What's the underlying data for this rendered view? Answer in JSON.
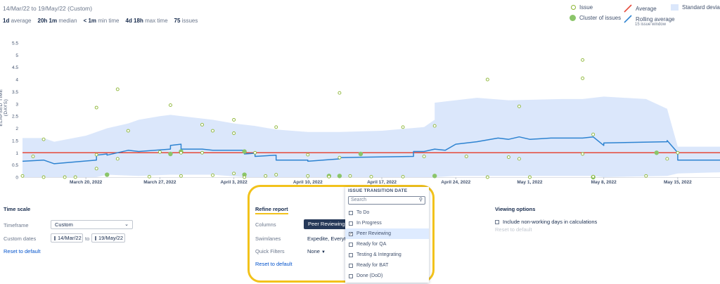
{
  "header": {
    "date_range": "14/Mar/22 to 19/May/22 (Custom)",
    "stats": [
      {
        "value": "1d",
        "label": "average"
      },
      {
        "value": "20h 1m",
        "label": "median"
      },
      {
        "value": "< 1m",
        "label": "min time"
      },
      {
        "value": "4d 18h",
        "label": "max time"
      },
      {
        "value": "75",
        "label": "issues"
      }
    ]
  },
  "legend": {
    "issue": "Issue",
    "cluster": "Cluster of issues",
    "average": "Average",
    "rolling": "Rolling average",
    "rolling_sub": "15 issue window",
    "stddev": "Standard deviation"
  },
  "colors": {
    "point": "#8bb532",
    "average": "#e5493a",
    "rolling": "#2d83d1",
    "band": "#dbe7fb",
    "highlight": "#f2c21b",
    "link": "#0052cc"
  },
  "chart_data": {
    "type": "scatter",
    "ylabel": "ELAPSED TIME (DAYS)",
    "ylim": [
      0,
      5.5
    ],
    "yticks": [
      "0",
      "0.5",
      "1",
      "1.5",
      "2",
      "2.5",
      "3",
      "3.5",
      "4",
      "4.5",
      "5",
      "5.5"
    ],
    "xlim": [
      "2022-03-14",
      "2022-05-19"
    ],
    "xticks": [
      {
        "date": "2022-03-20",
        "label": "March 20, 2022"
      },
      {
        "date": "2022-03-27",
        "label": "March 27, 2022"
      },
      {
        "date": "2022-04-03",
        "label": "April 3, 2022"
      },
      {
        "date": "2022-04-10",
        "label": "April 10, 2022"
      },
      {
        "date": "2022-04-17",
        "label": "April 17, 2022"
      },
      {
        "date": "2022-04-24",
        "label": "April 24, 2022"
      },
      {
        "date": "2022-05-01",
        "label": "May 1, 2022"
      },
      {
        "date": "2022-05-08",
        "label": "May 8, 2022"
      },
      {
        "date": "2022-05-15",
        "label": "May 15, 2022"
      }
    ],
    "average": 1.0,
    "issues": [
      [
        "2022-03-14",
        0.05
      ],
      [
        "2022-03-15",
        0.85
      ],
      [
        "2022-03-16",
        1.55
      ],
      [
        "2022-03-16",
        0.0
      ],
      [
        "2022-03-18",
        0.0
      ],
      [
        "2022-03-19",
        0.0
      ],
      [
        "2022-03-21",
        2.85
      ],
      [
        "2022-03-21",
        0.92
      ],
      [
        "2022-03-21",
        0.35
      ],
      [
        "2022-03-23",
        3.6
      ],
      [
        "2022-03-23",
        0.75
      ],
      [
        "2022-03-24",
        1.9
      ],
      [
        "2022-03-26",
        0.02
      ],
      [
        "2022-03-27",
        1.03
      ],
      [
        "2022-03-28",
        2.95
      ],
      [
        "2022-03-29",
        1.0
      ],
      [
        "2022-03-29",
        0.05
      ],
      [
        "2022-03-31",
        2.15
      ],
      [
        "2022-03-31",
        1.0
      ],
      [
        "2022-04-01",
        1.9
      ],
      [
        "2022-04-01",
        0.08
      ],
      [
        "2022-04-03",
        1.8
      ],
      [
        "2022-04-03",
        2.35
      ],
      [
        "2022-04-03",
        0.15
      ],
      [
        "2022-04-04",
        0.0
      ],
      [
        "2022-04-05",
        1.0
      ],
      [
        "2022-04-06",
        0.05
      ],
      [
        "2022-04-07",
        2.05
      ],
      [
        "2022-04-07",
        0.1
      ],
      [
        "2022-04-10",
        0.92
      ],
      [
        "2022-04-10",
        0.05
      ],
      [
        "2022-04-12",
        0.02
      ],
      [
        "2022-04-13",
        3.45
      ],
      [
        "2022-04-13",
        0.8
      ],
      [
        "2022-04-14",
        0.05
      ],
      [
        "2022-04-16",
        0.02
      ],
      [
        "2022-04-19",
        2.05
      ],
      [
        "2022-04-19",
        0.02
      ],
      [
        "2022-04-21",
        0.85
      ],
      [
        "2022-04-22",
        2.1
      ],
      [
        "2022-04-25",
        0.85
      ],
      [
        "2022-04-27",
        4.0
      ],
      [
        "2022-04-27",
        0.0
      ],
      [
        "2022-04-29",
        0.82
      ],
      [
        "2022-04-30",
        2.9
      ],
      [
        "2022-04-30",
        0.75
      ],
      [
        "2022-05-01",
        0.0
      ],
      [
        "2022-05-06",
        4.8
      ],
      [
        "2022-05-06",
        4.05
      ],
      [
        "2022-05-06",
        0.95
      ],
      [
        "2022-05-07",
        1.75
      ],
      [
        "2022-05-07",
        0.02
      ],
      [
        "2022-05-12",
        0.05
      ],
      [
        "2022-05-14",
        0.75
      ],
      [
        "2022-05-15",
        1.0
      ]
    ],
    "clusters": [
      [
        "2022-03-22",
        0.1
      ],
      [
        "2022-03-28",
        0.95
      ],
      [
        "2022-03-29",
        1.05
      ],
      [
        "2022-04-04",
        1.05
      ],
      [
        "2022-04-04",
        0.1
      ],
      [
        "2022-04-12",
        0.05
      ],
      [
        "2022-04-13",
        0.05
      ],
      [
        "2022-04-15",
        0.95
      ],
      [
        "2022-04-22",
        0.05
      ],
      [
        "2022-05-07",
        0.0
      ],
      [
        "2022-05-13",
        1.0
      ]
    ],
    "rolling_average": [
      [
        "2022-03-14",
        0.65
      ],
      [
        "2022-03-16",
        0.7
      ],
      [
        "2022-03-17",
        0.55
      ],
      [
        "2022-03-21",
        0.7
      ],
      [
        "2022-03-21",
        0.9
      ],
      [
        "2022-03-22",
        0.95
      ],
      [
        "2022-03-22",
        0.9
      ],
      [
        "2022-03-24",
        1.1
      ],
      [
        "2022-03-25",
        1.05
      ],
      [
        "2022-03-25",
        1.05
      ],
      [
        "2022-03-28",
        1.15
      ],
      [
        "2022-03-28",
        1.3
      ],
      [
        "2022-03-29",
        1.35
      ],
      [
        "2022-03-29",
        1.15
      ],
      [
        "2022-03-31",
        1.15
      ],
      [
        "2022-04-01",
        1.1
      ],
      [
        "2022-04-04",
        1.1
      ],
      [
        "2022-04-04",
        0.95
      ],
      [
        "2022-04-05",
        0.98
      ],
      [
        "2022-04-05",
        0.85
      ],
      [
        "2022-04-07",
        0.9
      ],
      [
        "2022-04-07",
        0.7
      ],
      [
        "2022-04-10",
        0.7
      ],
      [
        "2022-04-10",
        0.65
      ],
      [
        "2022-04-13",
        0.75
      ],
      [
        "2022-04-13",
        0.8
      ],
      [
        "2022-04-20",
        0.85
      ],
      [
        "2022-04-20",
        1.05
      ],
      [
        "2022-04-21",
        1.05
      ],
      [
        "2022-04-22",
        1.15
      ],
      [
        "2022-04-23",
        1.1
      ],
      [
        "2022-04-24",
        1.35
      ],
      [
        "2022-04-26",
        1.45
      ],
      [
        "2022-04-28",
        1.6
      ],
      [
        "2022-04-29",
        1.55
      ],
      [
        "2022-04-30",
        1.65
      ],
      [
        "2022-05-01",
        1.55
      ],
      [
        "2022-05-03",
        1.6
      ],
      [
        "2022-05-06",
        1.6
      ],
      [
        "2022-05-07",
        1.65
      ],
      [
        "2022-05-08",
        1.3
      ],
      [
        "2022-05-08",
        1.4
      ],
      [
        "2022-05-14",
        1.45
      ],
      [
        "2022-05-14",
        1.5
      ],
      [
        "2022-05-15",
        1.0
      ],
      [
        "2022-05-15",
        0.7
      ],
      [
        "2022-05-19",
        0.7
      ]
    ],
    "stddev_upper": [
      [
        "2022-03-14",
        1.6
      ],
      [
        "2022-03-16",
        1.6
      ],
      [
        "2022-03-17",
        1.45
      ],
      [
        "2022-03-20",
        1.7
      ],
      [
        "2022-03-22",
        2.0
      ],
      [
        "2022-03-24",
        2.2
      ],
      [
        "2022-03-25",
        2.35
      ],
      [
        "2022-03-27",
        2.5
      ],
      [
        "2022-03-28",
        2.55
      ],
      [
        "2022-04-01",
        2.35
      ],
      [
        "2022-04-03",
        2.2
      ],
      [
        "2022-04-05",
        2.1
      ],
      [
        "2022-04-07",
        1.95
      ],
      [
        "2022-04-10",
        1.85
      ],
      [
        "2022-04-13",
        1.85
      ],
      [
        "2022-04-17",
        1.9
      ],
      [
        "2022-04-21",
        2.05
      ],
      [
        "2022-04-22",
        2.35
      ],
      [
        "2022-04-22",
        3.05
      ],
      [
        "2022-04-26",
        3.25
      ],
      [
        "2022-04-29",
        3.15
      ],
      [
        "2022-05-04",
        3.2
      ],
      [
        "2022-05-06",
        3.2
      ],
      [
        "2022-05-08",
        3.3
      ],
      [
        "2022-05-12",
        3.2
      ],
      [
        "2022-05-14",
        2.8
      ],
      [
        "2022-05-15",
        1.25
      ],
      [
        "2022-05-19",
        1.25
      ]
    ],
    "stddev_lower": [
      [
        "2022-03-14",
        0.0
      ],
      [
        "2022-03-21",
        0.0
      ],
      [
        "2022-03-22",
        0.1
      ],
      [
        "2022-03-25",
        0.05
      ],
      [
        "2022-03-28",
        0.1
      ],
      [
        "2022-04-01",
        0.1
      ],
      [
        "2022-04-04",
        0.0
      ],
      [
        "2022-04-17",
        0.0
      ],
      [
        "2022-04-22",
        0.0
      ],
      [
        "2022-04-24",
        0.05
      ],
      [
        "2022-05-04",
        0.05
      ],
      [
        "2022-05-07",
        0.05
      ],
      [
        "2022-05-08",
        0.0
      ],
      [
        "2022-05-14",
        0.05
      ],
      [
        "2022-05-15",
        0.15
      ],
      [
        "2022-05-19",
        0.2
      ]
    ]
  },
  "timescale": {
    "title": "Time scale",
    "timeframe_label": "Timeframe",
    "timeframe_value": "Custom",
    "dates_label": "Custom dates",
    "from": "14/Mar/22",
    "to_word": "to",
    "to": "19/May/22",
    "reset": "Reset to default"
  },
  "refine": {
    "title": "Refine report",
    "columns_label": "Columns",
    "columns_value": "Peer Reviewing",
    "swimlanes_label": "Swimlanes",
    "swimlanes_value": "Expedite, Everythin",
    "quickfilters_label": "Quick Filters",
    "quickfilters_value": "None",
    "reset": "Reset to default"
  },
  "dropdown": {
    "title": "ISSUE TRANSITION DATE",
    "search_placeholder": "Search",
    "items": [
      {
        "label": "To Do",
        "checked": false
      },
      {
        "label": "In Progress",
        "checked": false
      },
      {
        "label": "Peer Reviewing",
        "checked": true
      },
      {
        "label": "Ready for QA",
        "checked": false
      },
      {
        "label": "Testing & Integrating",
        "checked": false
      },
      {
        "label": "Ready for BAT",
        "checked": false
      },
      {
        "label": "Done (DoD)",
        "checked": false
      }
    ]
  },
  "viewing": {
    "title": "Viewing options",
    "nonworking": "Include non-working days in calculations",
    "reset": "Reset to default"
  }
}
